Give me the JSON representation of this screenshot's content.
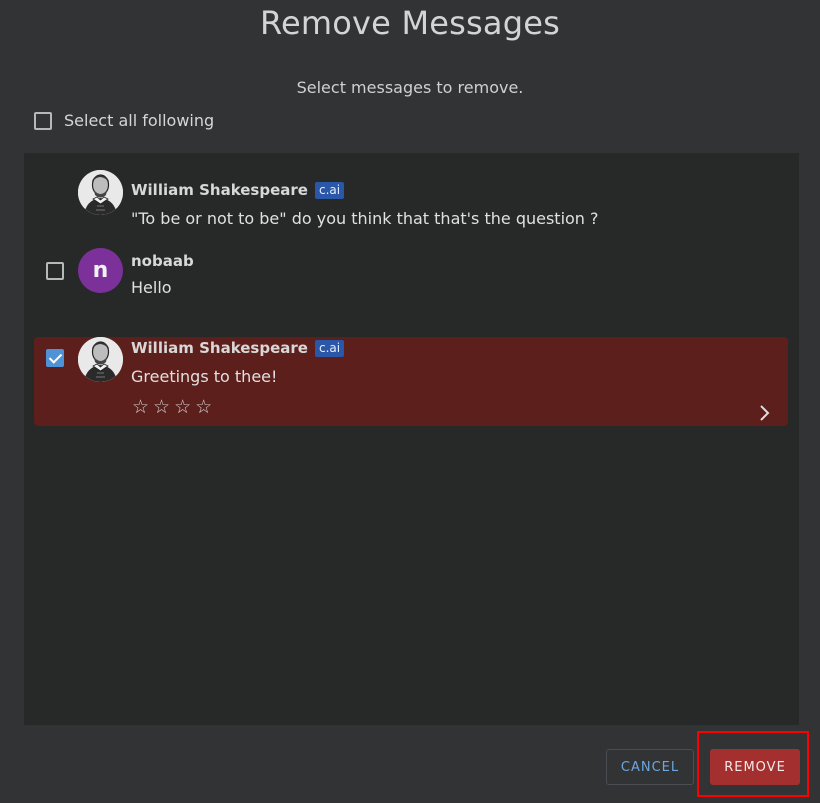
{
  "dialog": {
    "title": "Remove Messages",
    "subtitle": "Select messages to remove.",
    "select_all_label": "Select all following"
  },
  "messages": [
    {
      "author": "William Shakespeare",
      "badge": "c.ai",
      "text": "\"To be or not to be\" do you think that that's the question ?",
      "has_checkbox": false
    },
    {
      "author": "nobaab",
      "avatar_letter": "n",
      "text": "Hello",
      "has_checkbox": true,
      "checked": false
    },
    {
      "author": "William Shakespeare",
      "badge": "c.ai",
      "text": "Greetings to thee!",
      "has_checkbox": true,
      "checked": true,
      "rating_stars": "☆☆☆☆"
    }
  ],
  "buttons": {
    "cancel_label": "CANCEL",
    "remove_label": "REMOVE"
  },
  "colors": {
    "background": "#323335",
    "list_background": "#272828",
    "selected_row": "#5d1f1c",
    "remove_button": "#a3302e",
    "checkbox_checked": "#4e93d8",
    "badge": "#2b57a8",
    "highlight_box": "#ff0000"
  }
}
